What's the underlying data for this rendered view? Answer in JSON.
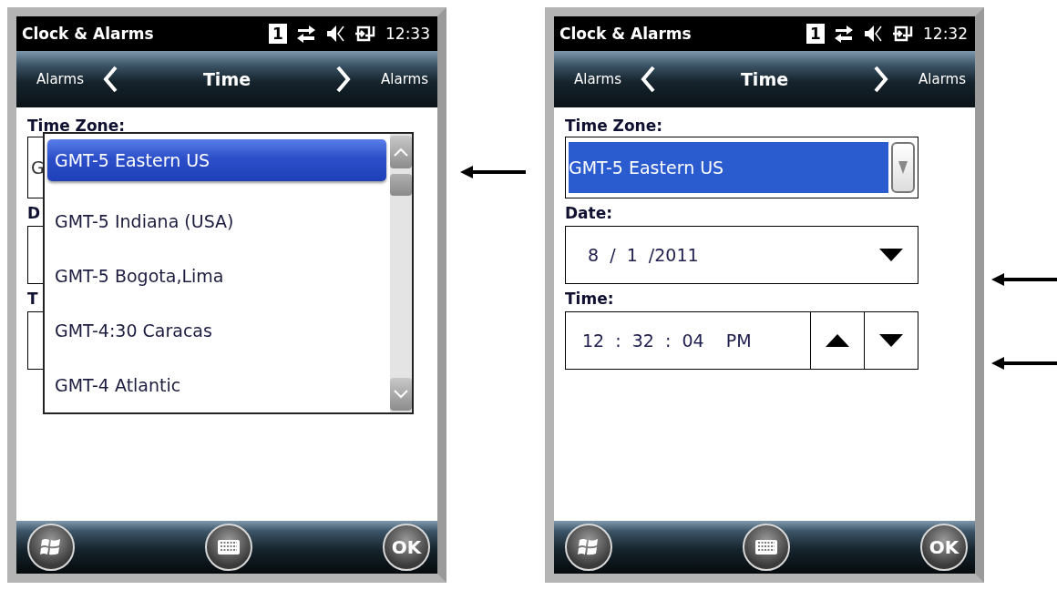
{
  "screens": [
    {
      "status": {
        "title": "Clock & Alarms",
        "badge": "1",
        "time": "12:33"
      },
      "nav": {
        "prev": "Alarms",
        "title": "Time",
        "next": "Alarms"
      },
      "fields": [
        {
          "kind": "select",
          "label": "Time Zone:",
          "value": "G",
          "highlighted": false
        },
        {
          "kind": "date",
          "label": "D"
        },
        {
          "kind": "time",
          "label": "T"
        }
      ],
      "dropdown": {
        "options": [
          {
            "label": "GMT-5 Eastern US",
            "selected": true
          },
          {
            "label": "GMT-5 Indiana (USA)",
            "selected": false
          },
          {
            "label": "GMT-5 Bogota,Lima",
            "selected": false
          },
          {
            "label": "GMT-4:30 Caracas",
            "selected": false
          },
          {
            "label": "GMT-4 Atlantic",
            "selected": false
          }
        ]
      },
      "softkeys": {
        "ok": "OK"
      }
    },
    {
      "status": {
        "title": "Clock & Alarms",
        "badge": "1",
        "time": "12:32"
      },
      "nav": {
        "prev": "Alarms",
        "title": "Time",
        "next": "Alarms"
      },
      "fields": [
        {
          "kind": "select",
          "label": "Time Zone:",
          "value": "GMT-5 Eastern US",
          "highlighted": true
        },
        {
          "kind": "date",
          "label": "Date:",
          "value": "8  /  1  /2011"
        },
        {
          "kind": "time",
          "label": "Time:",
          "value": "12  :  32  :  04    PM"
        }
      ],
      "softkeys": {
        "ok": "OK"
      }
    }
  ]
}
